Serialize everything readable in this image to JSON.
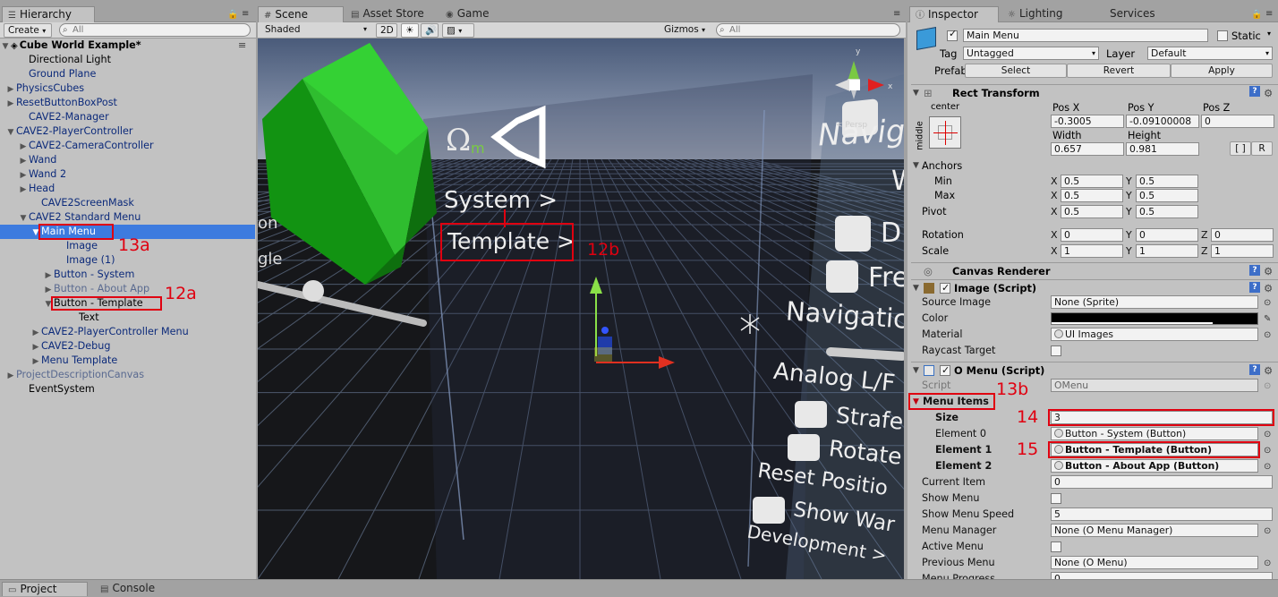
{
  "hierarchy": {
    "tab_label": "Hierarchy",
    "create_label": "Create",
    "search_placeholder": "All",
    "scene_name": "Cube World Example*",
    "items": [
      {
        "label": "Directional Light"
      },
      {
        "label": "Ground Plane"
      },
      {
        "label": "PhysicsCubes"
      },
      {
        "label": "ResetButtonBoxPost"
      },
      {
        "label": "CAVE2-Manager"
      },
      {
        "label": "CAVE2-PlayerController"
      },
      {
        "label": "CAVE2-CameraController"
      },
      {
        "label": "Wand"
      },
      {
        "label": "Wand 2"
      },
      {
        "label": "Head"
      },
      {
        "label": "CAVE2ScreenMask"
      },
      {
        "label": "CAVE2 Standard Menu"
      },
      {
        "label": "Main Menu"
      },
      {
        "label": "Image"
      },
      {
        "label": "Image (1)"
      },
      {
        "label": "Button - System"
      },
      {
        "label": "Button - About App"
      },
      {
        "label": "Button - Template"
      },
      {
        "label": "Text"
      },
      {
        "label": "CAVE2-PlayerController Menu"
      },
      {
        "label": "CAVE2-Debug"
      },
      {
        "label": "Menu Template"
      },
      {
        "label": "ProjectDescriptionCanvas"
      },
      {
        "label": "EventSystem"
      }
    ]
  },
  "scene": {
    "tabs": [
      {
        "label": "Scene"
      },
      {
        "label": "Asset Store"
      },
      {
        "label": "Game"
      }
    ],
    "shading": "Shaded",
    "mode_2d": "2D",
    "gizmos": "Gizmos",
    "search_placeholder": "All",
    "persp_label": "< Persp",
    "menu_texts": {
      "system": "System >",
      "template": "Template >",
      "left_on": "on",
      "left_gle": "gle",
      "nav1": "Navig",
      "w": "W",
      "d": "D",
      "fre": "Fre",
      "nav2": "Navigatic",
      "analog": "Analog L/F",
      "strafe": "Strafe",
      "rotate": "Rotate",
      "reset": "Reset Positio",
      "show": "Show War",
      "dev": "Development >"
    }
  },
  "annotations": {
    "a13a": "13a",
    "a12a": "12a",
    "a12b": "12b",
    "a13b": "13b",
    "a14": "14",
    "a15": "15"
  },
  "inspector": {
    "tabs": [
      {
        "label": "Inspector"
      },
      {
        "label": "Lighting"
      },
      {
        "label": "Services"
      }
    ],
    "object_name": "Main Menu",
    "static_label": "Static",
    "tag_label": "Tag",
    "tag_value": "Untagged",
    "layer_label": "Layer",
    "layer_value": "Default",
    "prefab_label": "Prefab",
    "prefab_select": "Select",
    "prefab_revert": "Revert",
    "prefab_apply": "Apply",
    "rect_transform": {
      "title": "Rect Transform",
      "anchor_h": "center",
      "anchor_v": "middle",
      "pos_x_label": "Pos X",
      "pos_y_label": "Pos Y",
      "pos_z_label": "Pos Z",
      "pos_x": "-0.3005",
      "pos_y": "-0.09100008",
      "pos_z": "0",
      "width_label": "Width",
      "height_label": "Height",
      "width": "0.657",
      "height": "0.981",
      "r_btn": "R",
      "anchors_label": "Anchors",
      "min_label": "Min",
      "max_label": "Max",
      "pivot_label": "Pivot",
      "min_x": "0.5",
      "min_y": "0.5",
      "max_x": "0.5",
      "max_y": "0.5",
      "pivot_x": "0.5",
      "pivot_y": "0.5",
      "rotation_label": "Rotation",
      "scale_label": "Scale",
      "rot_x": "0",
      "rot_y": "0",
      "rot_z": "0",
      "scale_x": "1",
      "scale_y": "1",
      "scale_z": "1",
      "x": "X",
      "y": "Y",
      "z": "Z"
    },
    "canvas_renderer": {
      "title": "Canvas Renderer"
    },
    "image_script": {
      "title": "Image (Script)",
      "source_image_label": "Source Image",
      "source_image": "None (Sprite)",
      "color_label": "Color",
      "material_label": "Material",
      "material": "UI Images",
      "raycast_label": "Raycast Target"
    },
    "omenu_script": {
      "title": "O Menu (Script)",
      "script_label": "Script",
      "script": "OMenu",
      "menu_items_label": "Menu Items",
      "size_label": "Size",
      "size": "3",
      "element0_label": "Element 0",
      "element0": "Button - System (Button)",
      "element1_label": "Element 1",
      "element1": "Button - Template (Button)",
      "element2_label": "Element 2",
      "element2": "Button - About App (Button)",
      "current_item_label": "Current Item",
      "current_item": "0",
      "show_menu_label": "Show Menu",
      "show_menu_speed_label": "Show Menu Speed",
      "show_menu_speed": "5",
      "menu_manager_label": "Menu Manager",
      "menu_manager": "None (O Menu Manager)",
      "active_menu_label": "Active Menu",
      "previous_menu_label": "Previous Menu",
      "previous_menu": "None (O Menu)",
      "menu_progress_label": "Menu Progress",
      "menu_progress": "0"
    }
  },
  "bottom": {
    "tabs": [
      {
        "label": "Project"
      },
      {
        "label": "Console"
      }
    ]
  }
}
